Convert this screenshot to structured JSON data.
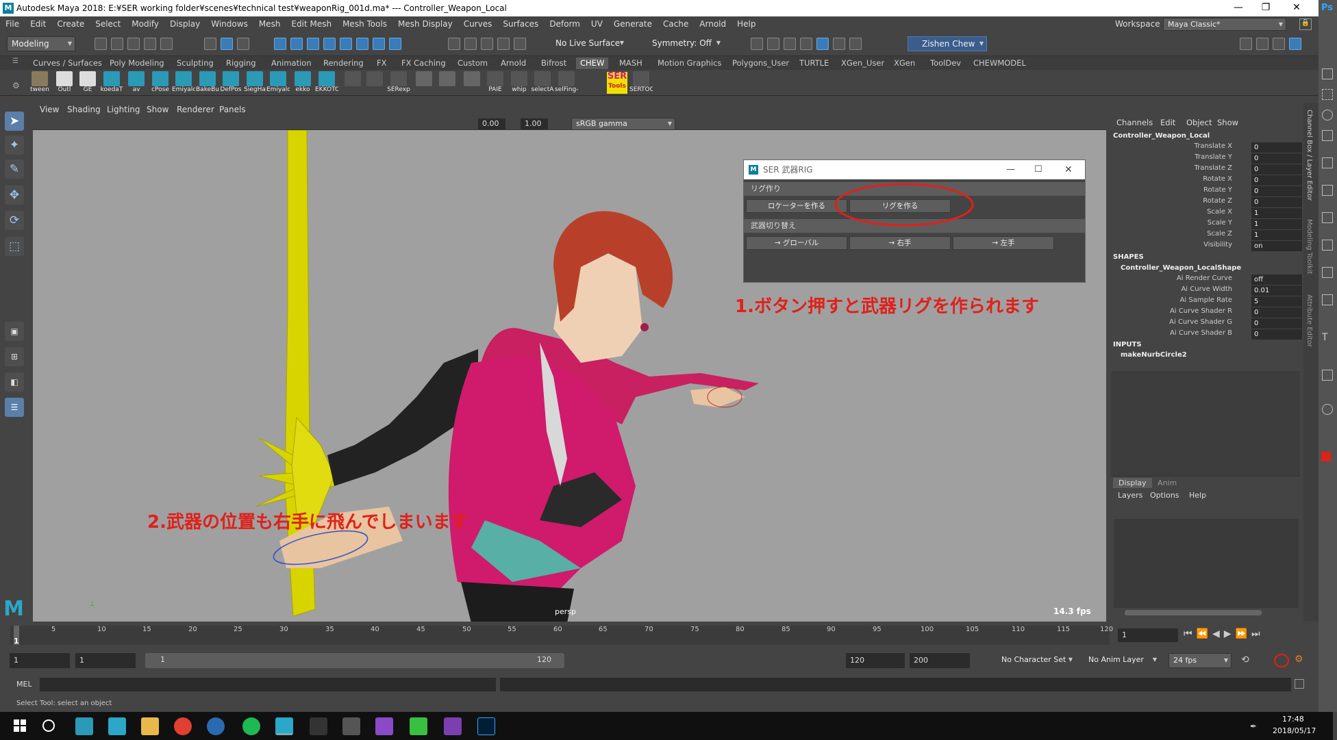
{
  "window": {
    "title": "Autodesk Maya 2018: E:¥SER working folder¥scenes¥technical test¥weaponRig_001d.ma*   ---   Controller_Weapon_Local",
    "controls": [
      "—",
      "❐",
      "✕"
    ]
  },
  "menubar": {
    "items": [
      "File",
      "Edit",
      "Create",
      "Select",
      "Modify",
      "Display",
      "Windows",
      "Mesh",
      "Edit Mesh",
      "Mesh Tools",
      "Mesh Display",
      "Curves",
      "Surfaces",
      "Deform",
      "UV",
      "Generate",
      "Cache",
      "Arnold",
      "Help"
    ],
    "workspace_label": "Workspace :",
    "workspace_value": "Maya Classic*"
  },
  "statusline": {
    "mode": "Modeling",
    "live_surface": "No Live Surface",
    "symmetry": "Symmetry: Off",
    "user": "Zishen Chew"
  },
  "shelf": {
    "tabs": [
      "Curves / Surfaces",
      "Poly Modeling",
      "Sculpting",
      "Rigging",
      "Animation",
      "Rendering",
      "FX",
      "FX Caching",
      "Custom",
      "Arnold",
      "Bifrost",
      "CHEW",
      "MASH",
      "Motion Graphics",
      "Polygons_User",
      "TURTLE",
      "XGen_User",
      "XGen",
      "ToolDev",
      "CHEWMODEL"
    ],
    "active_tab": "CHEW",
    "buttons": [
      "tween",
      "Outl",
      "GE",
      "koedaT",
      "av",
      "cPose",
      "Emiyalc",
      "BakeBu",
      "DefPos",
      "SiegHa",
      "Emiyalc",
      "ekko",
      "EKKOTC",
      "",
      "",
      "SERexp",
      "",
      "",
      "",
      "PAIE",
      "whip",
      "selectA",
      "selFing-",
      "",
      "SERTOC"
    ],
    "ser_logo_top": "SER",
    "ser_logo_bottom": "Tools"
  },
  "viewport": {
    "menu": [
      "View",
      "Shading",
      "Lighting",
      "Show",
      "Renderer",
      "Panels"
    ],
    "exposure": "0.00",
    "gamma": "1.00",
    "colorspace": "sRGB gamma",
    "camera": "persp",
    "fps": "14.3 fps"
  },
  "dialog": {
    "title": "SER 武器RIG",
    "section1": "リグ作り",
    "btn_locator": "ロケーターを作る",
    "btn_rig": "リグを作る",
    "section2": "武器切り替え",
    "btn_global": "→ グローバル",
    "btn_right": "→ 右手",
    "btn_left": "→ 左手"
  },
  "annotations": {
    "note1": "1.ボタン押すと武器リグを作られます",
    "note2": "2.武器の位置も右手に飛んでしまいます"
  },
  "channelbox": {
    "menu": [
      "Channels",
      "Edit",
      "Object",
      "Show"
    ],
    "object": "Controller_Weapon_Local",
    "channels": [
      {
        "k": "Translate X",
        "v": "0"
      },
      {
        "k": "Translate Y",
        "v": "0"
      },
      {
        "k": "Translate Z",
        "v": "0"
      },
      {
        "k": "Rotate X",
        "v": "0"
      },
      {
        "k": "Rotate Y",
        "v": "0"
      },
      {
        "k": "Rotate Z",
        "v": "0"
      },
      {
        "k": "Scale X",
        "v": "1"
      },
      {
        "k": "Scale Y",
        "v": "1"
      },
      {
        "k": "Scale Z",
        "v": "1"
      },
      {
        "k": "Visibility",
        "v": "on"
      }
    ],
    "shapes_label": "SHAPES",
    "shape_name": "Controller_Weapon_LocalShape",
    "shape_channels": [
      {
        "k": "Ai Render Curve",
        "v": "off"
      },
      {
        "k": "Ai Curve Width",
        "v": "0.01"
      },
      {
        "k": "Ai Sample Rate",
        "v": "5"
      },
      {
        "k": "Ai Curve Shader R",
        "v": "0"
      },
      {
        "k": "Ai Curve Shader G",
        "v": "0"
      },
      {
        "k": "Ai Curve Shader B",
        "v": "0"
      }
    ],
    "inputs_label": "INPUTS",
    "input_name": "makeNurbCircle2",
    "layer_tabs": [
      "Display",
      "Anim"
    ],
    "layer_menu": [
      "Layers",
      "Options",
      "Help"
    ],
    "side_tabs": [
      "Channel Box / Layer Editor",
      "Modeling Toolkit",
      "Attribute Editor"
    ]
  },
  "timeline": {
    "ticks": [
      "5",
      "10",
      "15",
      "20",
      "25",
      "30",
      "35",
      "40",
      "45",
      "50",
      "55",
      "60",
      "65",
      "70",
      "75",
      "80",
      "85",
      "90",
      "95",
      "100",
      "105",
      "110",
      "115",
      "120"
    ],
    "first_tick": "1",
    "current_frame": "1"
  },
  "range": {
    "start": "1",
    "playback_start": "1",
    "slider_start": "1",
    "slider_end": "120",
    "playback_end": "120",
    "end": "200",
    "character_set": "No Character Set",
    "anim_layer": "No Anim Layer",
    "fps": "24 fps"
  },
  "cmdline": {
    "label": "MEL"
  },
  "helpline": {
    "text": "Select Tool: select an object"
  },
  "taskbar": {
    "time": "17:48",
    "date": "2018/05/17"
  },
  "photoshop": {
    "label": "Ps"
  },
  "colors": {
    "accent": "#e0201a",
    "weapon": "#d8d400",
    "selected_blue": "#3a7cb8"
  }
}
